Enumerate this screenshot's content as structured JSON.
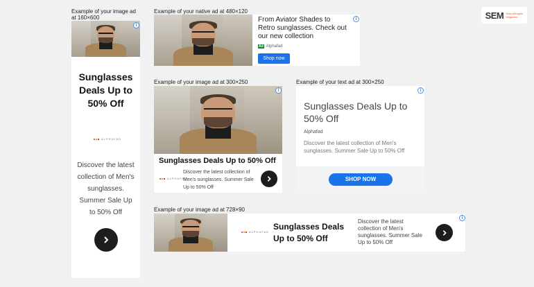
{
  "captions": {
    "ad160": "Example of your image ad at 160×600",
    "native": "Example of your native ad at 480×120",
    "img300": "Example of your image ad at 300×250",
    "text300": "Example of your text ad at 300×250",
    "ad728": "Example of your image ad at 728×90"
  },
  "brand_logo": {
    "main": "SEM",
    "sub1": "SearchEngine",
    "sub2": "Magazine"
  },
  "ad160": {
    "headline": "Sunglasses Deals Up to 50% Off",
    "logo": "ALPHAFAD",
    "body": "Discover the latest collection of Men's sunglasses. Summer Sale Up to 50% Off"
  },
  "native": {
    "headline": "From Aviator Shades to Retro sunglasses. Check out our new collection",
    "ad_badge": "Ad",
    "advertiser": "Alphafad",
    "button": "Shop now"
  },
  "img300": {
    "headline": "Sunglasses Deals Up to 50% Off",
    "logo": "ALPHAFAD",
    "body": "Discover the latest collection of Men's sunglasses. Summer Sale Up to 50% Off"
  },
  "text300": {
    "headline": "Sunglasses Deals Up to 50% Off",
    "advertiser": "Alphafad",
    "body": "Discover the latest collection of Men's sunglasses. Summer Sale Up to 50% Off",
    "button": "SHOP NOW"
  },
  "ad728": {
    "logo": "ALPHAFAD",
    "headline": "Sunglasses Deals Up to 50% Off",
    "body": "Discover the latest collection of Men's sunglasses. Summer Sale Up to 50% Off"
  },
  "icons": {
    "info": "info-icon",
    "arrow": "chevron-right-icon"
  },
  "colors": {
    "accent": "#1a73e8",
    "text": "#222222",
    "background": "#f1f1f1"
  }
}
